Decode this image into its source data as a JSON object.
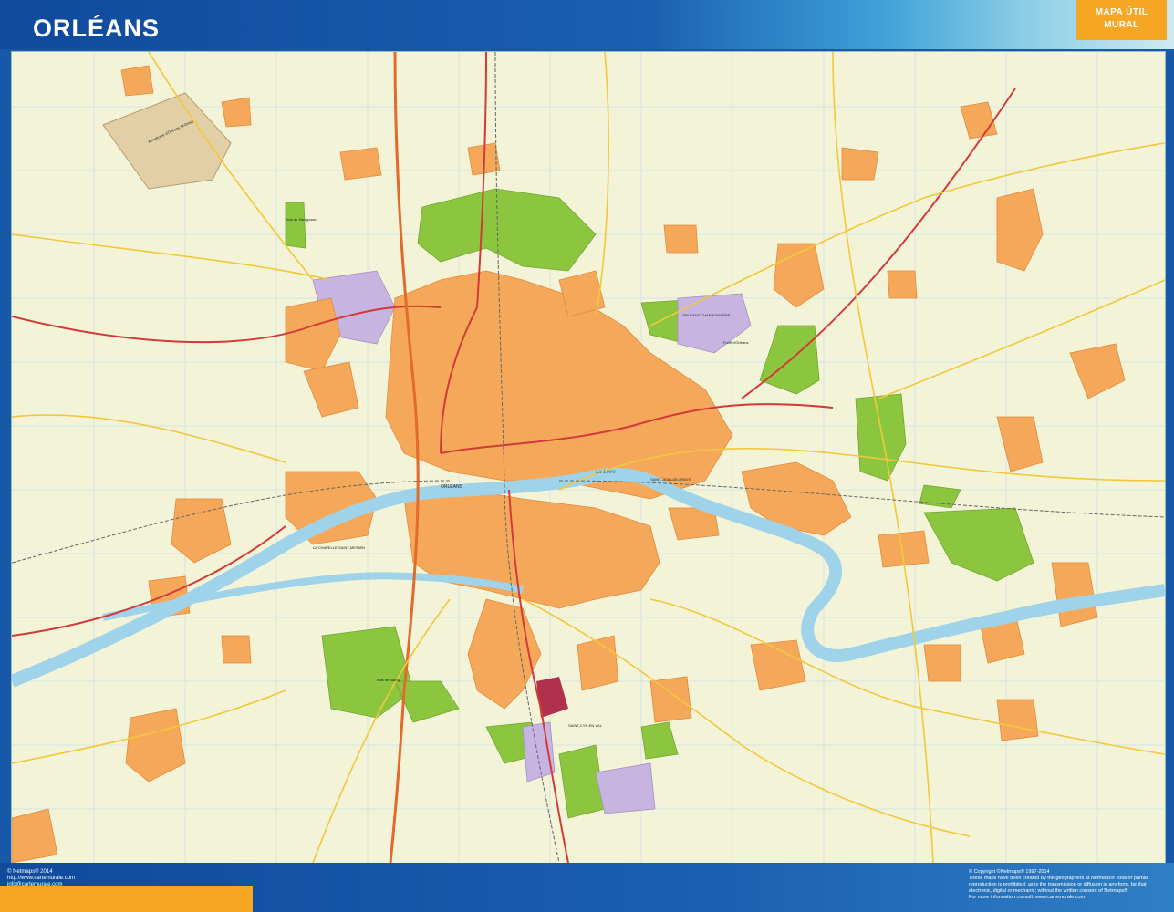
{
  "header": {
    "title": "ORLÉANS",
    "badge_line1": "MAPA ÚTIL",
    "badge_line2": "MURAL"
  },
  "map": {
    "river_label": "La Loire",
    "labels": {
      "city_centre": "ORLÉANS",
      "forest": "Forêt d'Orléans",
      "bois": "Bois de Saragosse",
      "technopole": "ORLÉANS CHARBONNIÈRE",
      "airfield": "Aérodrome d'Orléans St-Denis",
      "south_town": "SAINT-CYR-EN-VAL",
      "west_town": "LA CHAPELLE-SAINT-MESMIN",
      "east_town": "SAINT-JEAN-DE-BRAYE",
      "south_wood": "Bois de Marcy"
    },
    "colors": {
      "background": "#f3f3d8",
      "urban": "#f6a85a",
      "forest": "#8cc63f",
      "industrial": "#c8b4e0",
      "river": "#9fd3ea",
      "main_road": "#d23a3a",
      "secondary_road": "#f2c83a",
      "grid": "#c9dfe8"
    }
  },
  "footer": {
    "left_line1": "© Netmaps® 2014",
    "left_line2": "http://www.cartemurale.com",
    "left_line3": "info@cartemurale.com",
    "right_line1": "© Copyright ©Netmaps® 1997-2014",
    "right_line2": "These maps have been created by the geographers at Netmaps® Total or partial",
    "right_line3": "reproduction is prohibited; as is the transmission or diffusion in any form, be that",
    "right_line4": "electronic, digital or mechanic; without the written consent of Netmaps®",
    "right_line5": "For more information consult: www.cartemurale.com"
  }
}
